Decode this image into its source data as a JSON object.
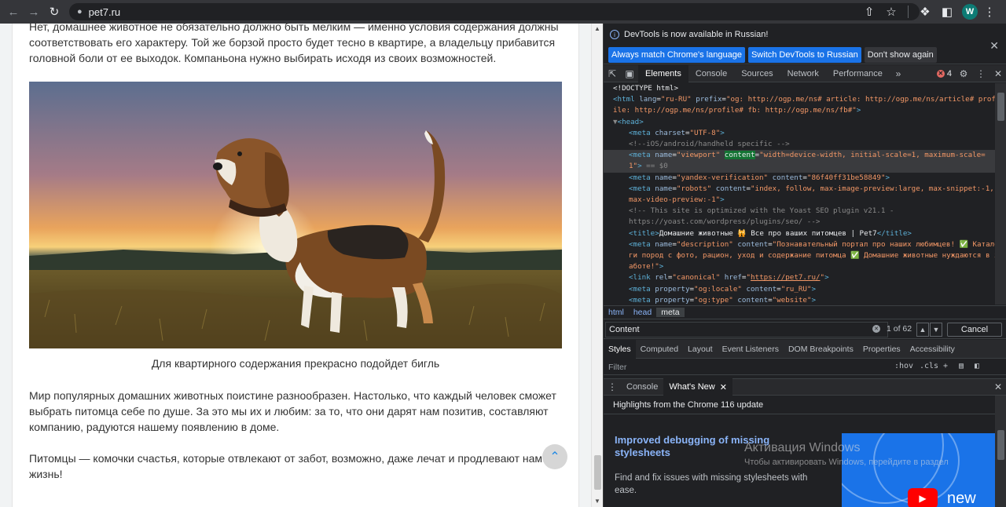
{
  "browser": {
    "url": "pet7.ru",
    "avatar_letter": "W"
  },
  "article": {
    "para1": "Нет, домашнее животное не обязательно должно быть мелким — именно условия содержания должны соответствовать его характеру. Той же борзой просто будет тесно в квартире, а владельцу прибавится головной боли от ее выходок. Компаньона нужно выбирать исходя из своих возможностей.",
    "caption": "Для квартирного содержания прекрасно подойдет бигль",
    "para2": "Мир популярных домашних животных поистине разнообразен. Настолько, что каждый человек сможет выбрать питомца себе по душе. За это мы их и любим: за то, что они дарят нам позитив, составляют компанию, радуются нашему появлению в доме.",
    "para3": "Питомцы — комочки счастья, которые отвлекают от забот, возможно, даже лечат и продлевают нам жизнь!"
  },
  "devtools": {
    "infobar": {
      "message": "DevTools is now available in Russian!",
      "btn_match": "Always match Chrome's language",
      "btn_switch": "Switch DevTools to Russian",
      "btn_dont_show": "Don't show again"
    },
    "tabs": [
      "Elements",
      "Console",
      "Sources",
      "Network",
      "Performance"
    ],
    "error_count": "4",
    "breadcrumbs": [
      "html",
      "head",
      "meta"
    ],
    "search": {
      "value": "Content",
      "count": "1 of 62",
      "cancel": "Cancel"
    },
    "sub_tabs": [
      "Styles",
      "Computed",
      "Layout",
      "Event Listeners",
      "DOM Breakpoints",
      "Properties",
      "Accessibility"
    ],
    "filter": {
      "placeholder": "Filter",
      "hov": ":hov",
      "cls": ".cls"
    },
    "drawer": {
      "tab_console": "Console",
      "tab_whats_new": "What's New",
      "heading": "Highlights from the Chrome 116 update",
      "title": "Improved debugging of missing stylesheets",
      "desc": "Find and fix issues with missing stylesheets with ease.",
      "thumb_text": "new"
    }
  },
  "watermark": {
    "line1": "Активация Windows",
    "line2": "Чтобы активировать Windows, перейдите в раздел"
  },
  "colors": {
    "accent": "#1a73e8",
    "link": "#8ab4f8"
  }
}
